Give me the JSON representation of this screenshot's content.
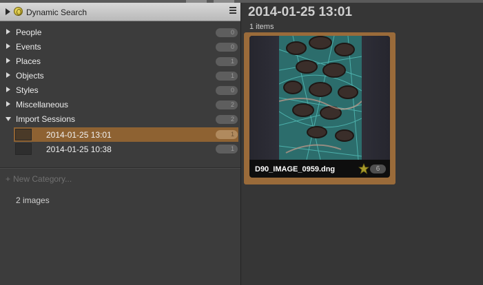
{
  "sidebar": {
    "header": {
      "title": "Dynamic Search"
    },
    "categories": [
      {
        "label": "People",
        "count": "0"
      },
      {
        "label": "Events",
        "count": "0"
      },
      {
        "label": "Places",
        "count": "1"
      },
      {
        "label": "Objects",
        "count": "1"
      },
      {
        "label": "Styles",
        "count": "0"
      },
      {
        "label": "Miscellaneous",
        "count": "2"
      }
    ],
    "import_sessions": {
      "label": "Import Sessions",
      "count": "2",
      "items": [
        {
          "label": "2014-01-25 13:01",
          "count": "1",
          "selected": true
        },
        {
          "label": "2014-01-25 10:38",
          "count": "1",
          "selected": false
        }
      ]
    },
    "new_category": "New Category...",
    "images_count": "2 images"
  },
  "main": {
    "title": "2014-01-25 13:01",
    "subtitle": "1 items",
    "items": [
      {
        "filename": "D90_IMAGE_0959.dng",
        "badge_number": "6",
        "star_icon": "star-icon"
      }
    ]
  },
  "colors": {
    "selection": "#8e6232",
    "card_border": "#9a6b3a",
    "header_bg": "#c8c8c8"
  }
}
